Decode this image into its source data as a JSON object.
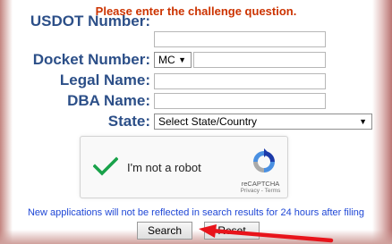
{
  "form": {
    "challenge": "Please enter the challenge question.",
    "usdot_label": "USDOT Number:",
    "usdot_value": "",
    "docket_label": "Docket Number:",
    "docket_prefix": "MC",
    "docket_value": "",
    "legal_label": "Legal Name:",
    "legal_value": "",
    "dba_label": "DBA Name:",
    "dba_value": "",
    "state_label": "State:",
    "state_selected": "Select State/Country"
  },
  "captcha": {
    "checkbox_text": "I'm not a robot",
    "brand": "reCAPTCHA",
    "terms": "Privacy - Terms"
  },
  "notice": "New applications will not be reflected in search results for 24 hours after filing",
  "buttons": {
    "search": "Search",
    "reset": "Reset"
  },
  "colors": {
    "label": "#2c4f88",
    "challenge": "#cc3300",
    "notice": "#1f47d6",
    "annotation_arrow": "#e8141b"
  }
}
